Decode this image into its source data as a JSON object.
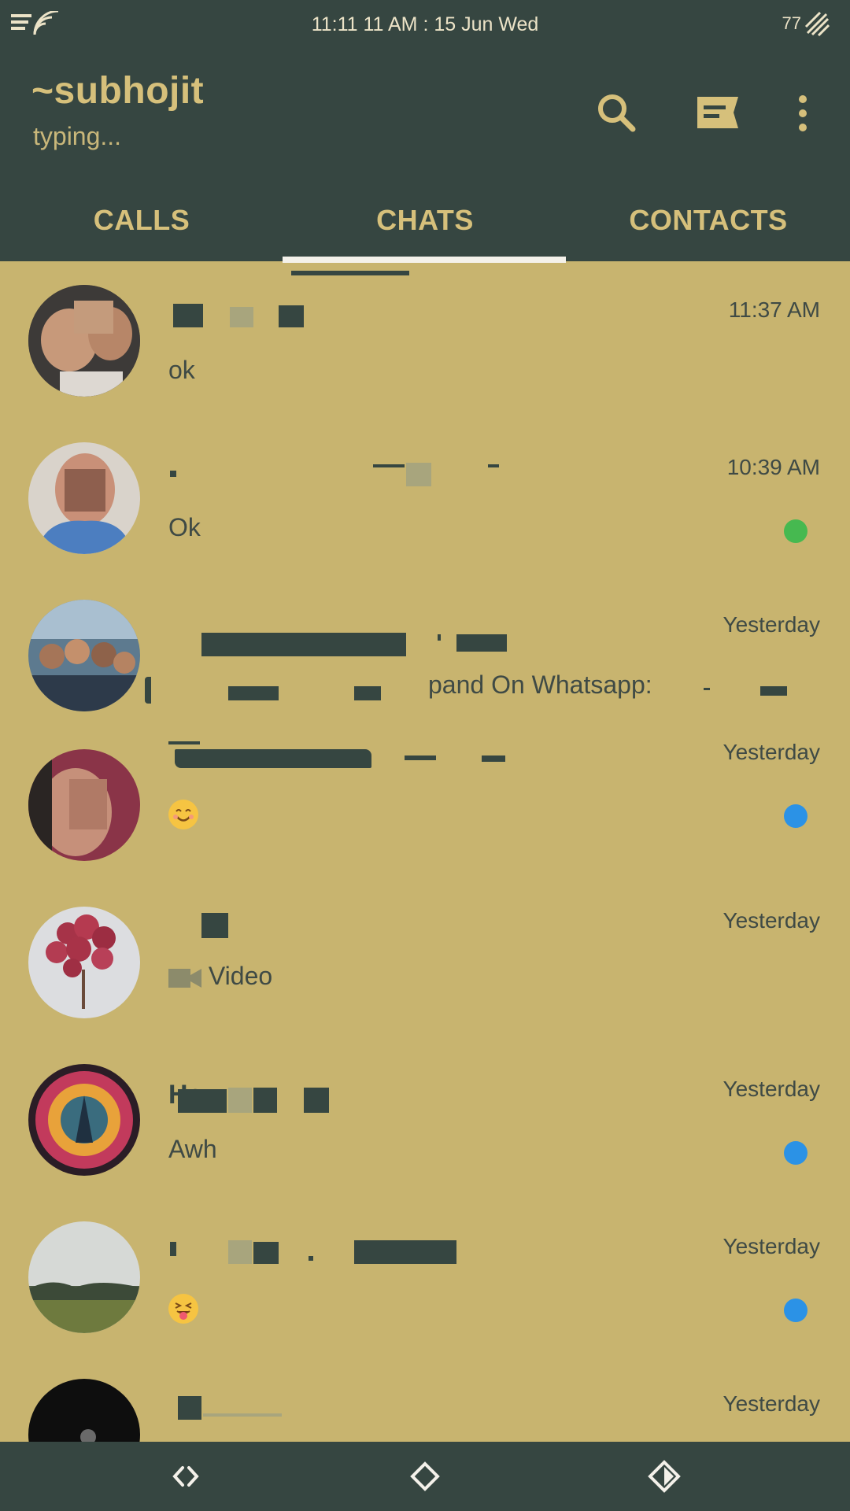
{
  "status_bar": {
    "time": "11:11 11 AM : 15 Jun Wed",
    "battery": "77",
    "signal_icon": "signal-wifi-icon",
    "battery_icon": "battery-icon"
  },
  "header": {
    "title": "~subhojit",
    "subtitle": "typing...",
    "icons": [
      "search-icon",
      "new-chat-icon",
      "more-vert-icon"
    ]
  },
  "tabs": [
    {
      "label": "CALLS"
    },
    {
      "label": "CHATS",
      "active": true
    },
    {
      "label": "CONTACTS"
    }
  ],
  "chats": [
    {
      "name": "",
      "time": "11:37 AM",
      "message": "ok",
      "unread": false
    },
    {
      "name": "",
      "time": "10:39 AM",
      "message": "Ok",
      "unread": true,
      "dot_color": "#46b950"
    },
    {
      "name": "",
      "time": "Yesterday",
      "message": "pand On Whatsapp:",
      "unread": false
    },
    {
      "name": "",
      "time": "Yesterday",
      "message": "",
      "message_icon": "smiley-emoji-icon",
      "unread": true,
      "dot_color": "#2b92e6"
    },
    {
      "name": "",
      "time": "Yesterday",
      "message": "Video",
      "message_icon": "video-camera-icon",
      "unread": false
    },
    {
      "name": "Ha",
      "time": "Yesterday",
      "message": "Awh",
      "unread": true,
      "dot_color": "#2b92e6"
    },
    {
      "name": "",
      "time": "Yesterday",
      "message": "",
      "message_icon": "tongue-out-emoji-icon",
      "unread": true,
      "dot_color": "#2b92e6"
    },
    {
      "name": "",
      "time": "Yesterday",
      "message": "",
      "unread": false
    }
  ],
  "nav_bar": {
    "icons": [
      "back-nav-icon",
      "home-nav-icon",
      "recents-nav-icon"
    ]
  },
  "colors": {
    "header_bg": "#364641",
    "list_bg": "#c8b46f",
    "accent_text": "#d6c07b",
    "tab_indicator": "#f4f1ea"
  }
}
